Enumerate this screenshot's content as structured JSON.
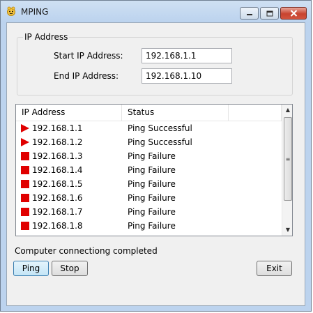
{
  "window": {
    "title": "MPING",
    "icon": "app-face-icon",
    "controls": {
      "minimize_icon": "minimize-icon",
      "maximize_icon": "maximize-icon",
      "close_icon": "close-icon"
    }
  },
  "ip_group": {
    "title": "IP Address",
    "start_label": "Start IP Address:",
    "start_value": "192.168.1.1",
    "end_label": "End  IP Address:",
    "end_value": "192.168.1.10"
  },
  "list": {
    "columns": [
      "IP Address",
      "Status"
    ],
    "rows": [
      {
        "ip": "192.168.1.1",
        "status": "Ping Successful",
        "icon": "success-triangle-icon"
      },
      {
        "ip": "192.168.1.2",
        "status": "Ping Successful",
        "icon": "success-triangle-icon"
      },
      {
        "ip": "192.168.1.3",
        "status": "Ping Failure",
        "icon": "failure-square-icon"
      },
      {
        "ip": "192.168.1.4",
        "status": "Ping Failure",
        "icon": "failure-square-icon"
      },
      {
        "ip": "192.168.1.5",
        "status": "Ping Failure",
        "icon": "failure-square-icon"
      },
      {
        "ip": "192.168.1.6",
        "status": "Ping Failure",
        "icon": "failure-square-icon"
      },
      {
        "ip": "192.168.1.7",
        "status": "Ping Failure",
        "icon": "failure-square-icon"
      },
      {
        "ip": "192.168.1.8",
        "status": "Ping Failure",
        "icon": "failure-square-icon"
      }
    ]
  },
  "status": {
    "text": "Computer connectiong completed"
  },
  "buttons": {
    "ping": "Ping",
    "stop": "Stop",
    "exit": "Exit"
  },
  "colors": {
    "status_icon": "#e00000",
    "title_bar": "#bcd3ee",
    "close_button": "#c8432f"
  }
}
